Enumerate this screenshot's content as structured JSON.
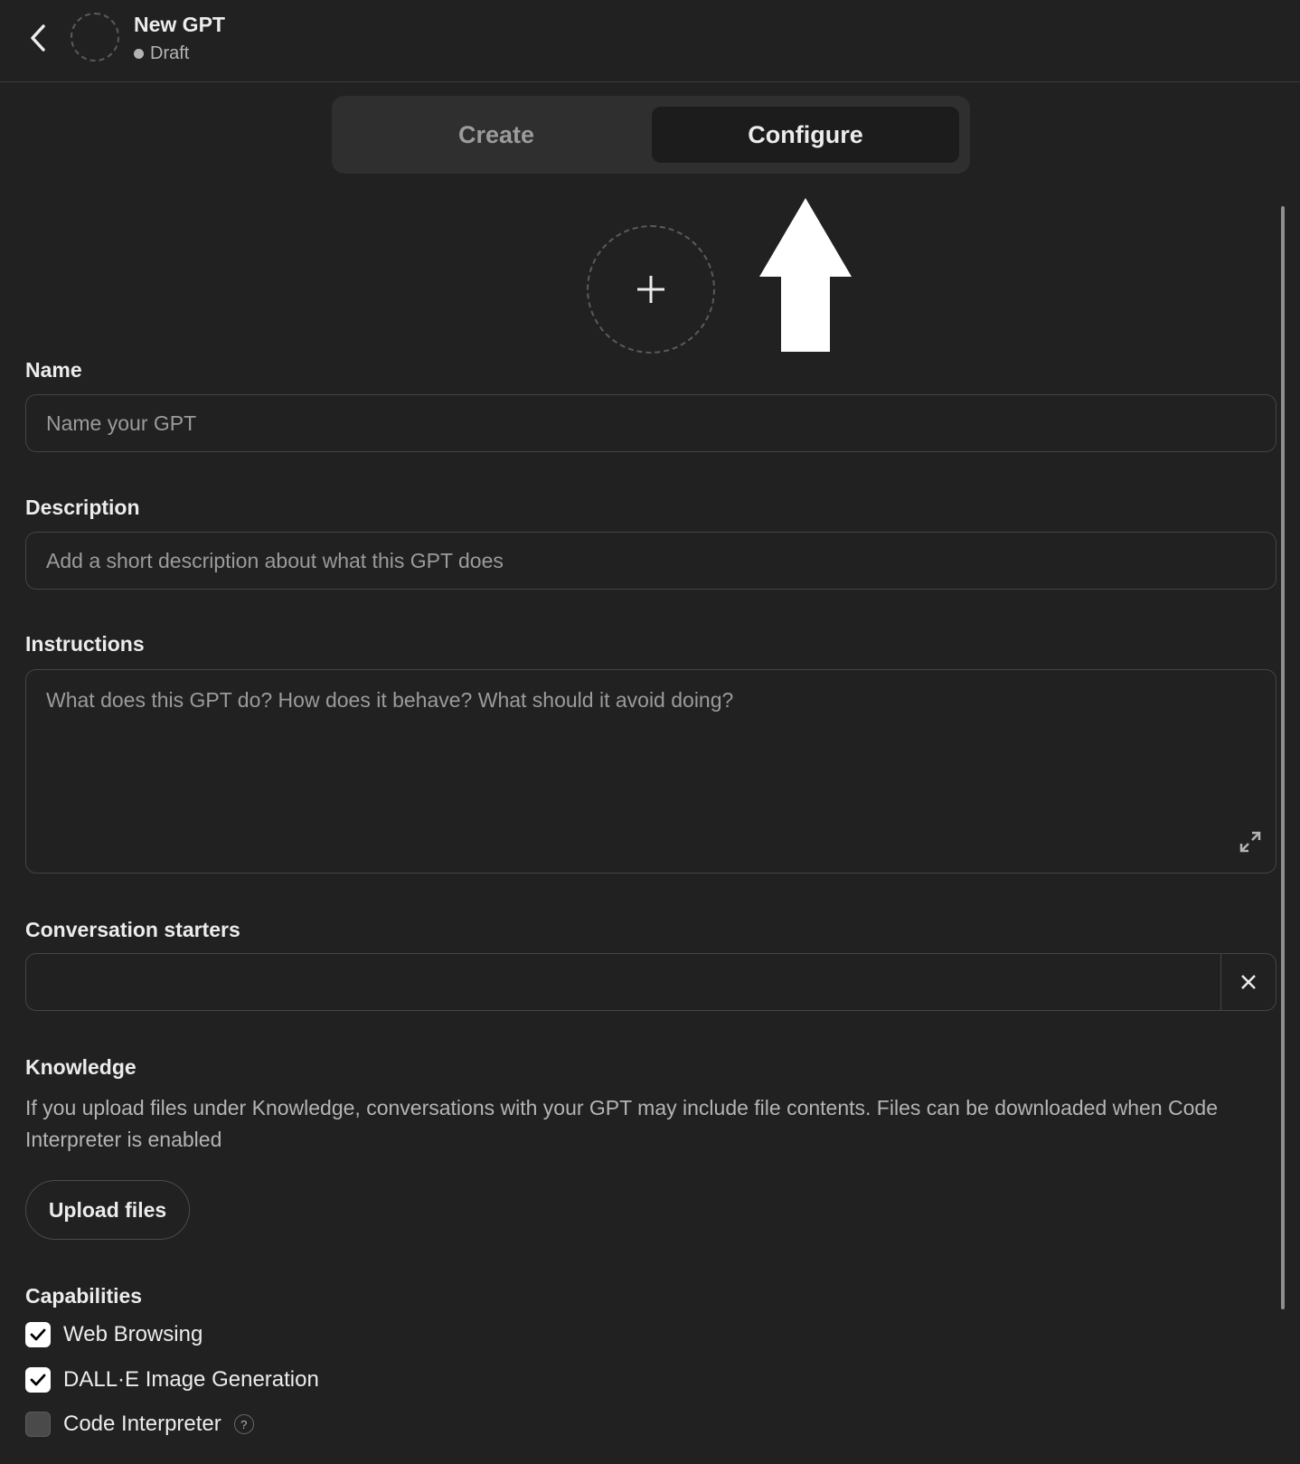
{
  "header": {
    "title": "New GPT",
    "status": "Draft"
  },
  "tabs": [
    {
      "label": "Create",
      "active": false
    },
    {
      "label": "Configure",
      "active": true
    }
  ],
  "form": {
    "name": {
      "label": "Name",
      "placeholder": "Name your GPT",
      "value": ""
    },
    "description": {
      "label": "Description",
      "placeholder": "Add a short description about what this GPT does",
      "value": ""
    },
    "instructions": {
      "label": "Instructions",
      "placeholder": "What does this GPT do? How does it behave? What should it avoid doing?",
      "value": ""
    },
    "conversation_starters": {
      "label": "Conversation starters",
      "items": [
        ""
      ]
    },
    "knowledge": {
      "label": "Knowledge",
      "description": "If you upload files under Knowledge, conversations with your GPT may include file contents. Files can be downloaded when Code Interpreter is enabled",
      "upload_label": "Upload files"
    },
    "capabilities": {
      "label": "Capabilities",
      "items": [
        {
          "label": "Web Browsing",
          "checked": true
        },
        {
          "label": "DALL·E Image Generation",
          "checked": true
        },
        {
          "label": "Code Interpreter",
          "checked": false,
          "help": "?"
        }
      ]
    }
  },
  "icons": {
    "back": "chevron-left-icon",
    "avatar_placeholder": "dashed-circle",
    "add": "plus-icon",
    "annotation": "arrow-up-icon",
    "expand": "expand-icon",
    "remove": "close-icon",
    "check": "check-icon",
    "help": "question-icon"
  },
  "colors": {
    "background": "#212121",
    "tab_container": "#2f2f2f",
    "active_tab": "#1c1c1c",
    "border": "#444444",
    "text": "#ececec",
    "muted_text": "#9b9b9b"
  }
}
